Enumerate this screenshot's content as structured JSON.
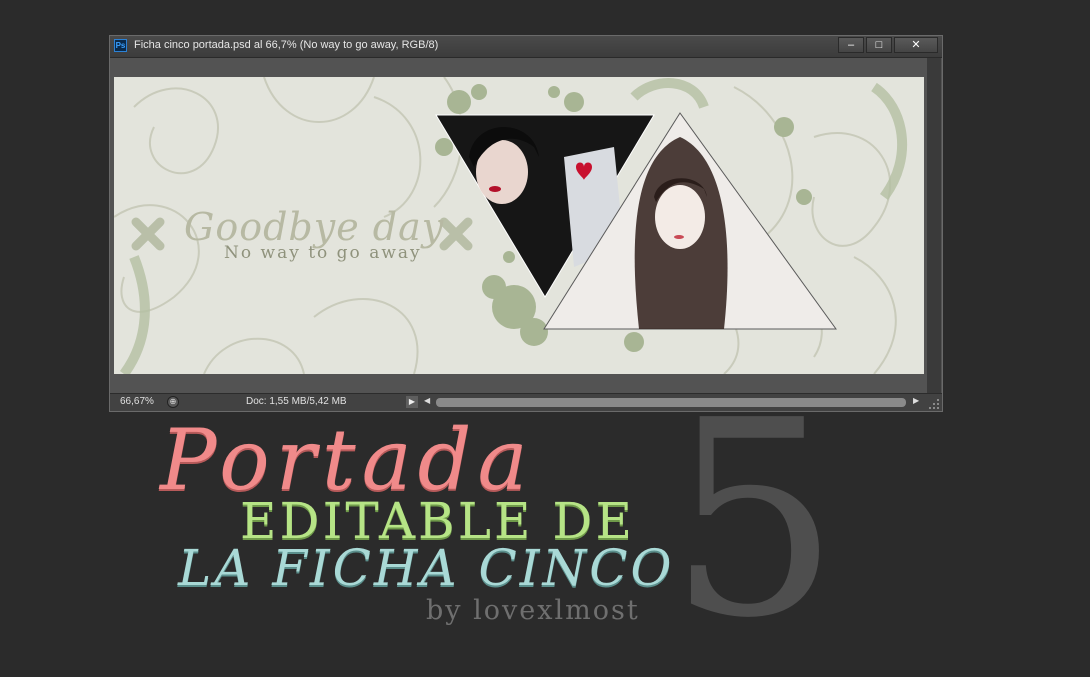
{
  "window": {
    "app_icon": "Ps",
    "title": "Ficha cinco portada.psd al 66,7% (No way  to go away, RGB/8)",
    "buttons": {
      "minimize": "–",
      "maximize": "□",
      "close": "✕"
    }
  },
  "artwork": {
    "title": "Goodbye day",
    "subtitle": "No way  to go away"
  },
  "statusbar": {
    "zoom": "66,67%",
    "doc_size": "Doc: 1,55 MB/5,42 MB",
    "arrow": "▶",
    "scroll_left": "◀",
    "scroll_right": "▶"
  },
  "overlay": {
    "portada": "Portada",
    "editable": "EDITABLE DE",
    "laficha": "LA FICHA CINCO",
    "byline": "by lovexlmost",
    "number": "5"
  },
  "colors": {
    "background": "#2b2b2b",
    "portada": "#f08a8a",
    "editable": "#b6e486",
    "laficha": "#a9d9d6",
    "artwork_bg": "#e3e4dc",
    "artwork_green": "#a8b594"
  }
}
